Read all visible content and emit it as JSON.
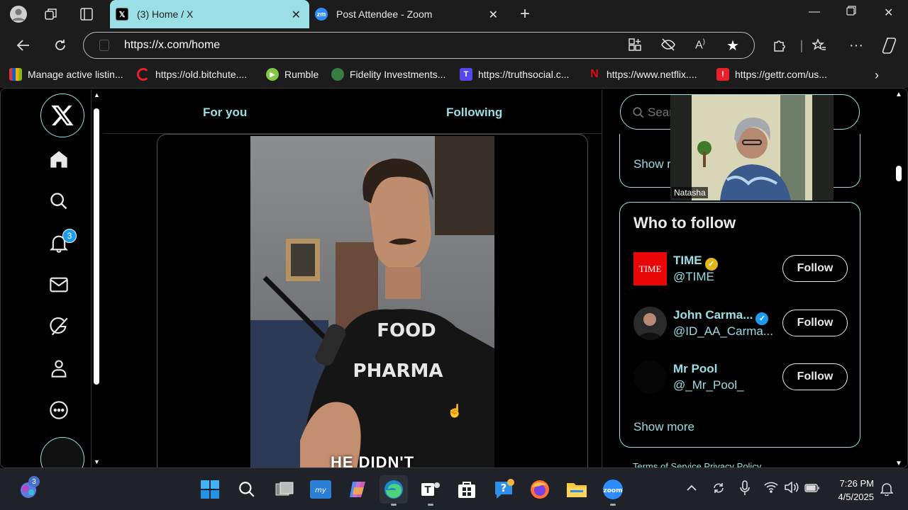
{
  "browser": {
    "tabs": [
      {
        "title": "(3) Home / X",
        "active": true,
        "icon": "x-logo-icon"
      },
      {
        "title": "Post Attendee - Zoom",
        "active": false,
        "icon": "zoom-logo-icon"
      }
    ],
    "address": "https://x.com/home",
    "bookmarks": [
      {
        "label": "Manage active listin...",
        "icon": "ebay-icon"
      },
      {
        "label": "https://old.bitchute....",
        "icon": "bitchute-icon"
      },
      {
        "label": "Rumble",
        "icon": "rumble-icon"
      },
      {
        "label": "Fidelity Investments...",
        "icon": "fidelity-icon"
      },
      {
        "label": "https://truthsocial.c...",
        "icon": "truthsocial-icon"
      },
      {
        "label": "https://www.netflix....",
        "icon": "netflix-icon"
      },
      {
        "label": "https://gettr.com/us...",
        "icon": "gettr-icon"
      }
    ]
  },
  "x": {
    "logo": "X",
    "notifications_badge": "3",
    "feed_tabs": [
      "For you",
      "Following"
    ],
    "video": {
      "shirt_text_1": "FOOD",
      "shirt_text_2": "PHARMA",
      "caption": "HE DIDN'T"
    },
    "search_placeholder": "Sear",
    "top_show_more": "Show r",
    "who_to_follow": {
      "title": "Who to follow",
      "accounts": [
        {
          "name": "TIME",
          "handle": "@TIME",
          "avatar_text": "TIME",
          "verified": "gold",
          "button": "Follow"
        },
        {
          "name": "John Carma...",
          "handle": "@ID_AA_Carma...",
          "verified": "blue",
          "button": "Follow"
        },
        {
          "name": "Mr Pool",
          "handle": "@_Mr_Pool_",
          "verified": "",
          "button": "Follow"
        }
      ],
      "show_more": "Show more"
    },
    "footer_links": "Terms of Service   Privacy Policy"
  },
  "zoom": {
    "participant_name": "Natasha"
  },
  "taskbar": {
    "widgets_badge": "3",
    "time": "7:26 PM",
    "date": "4/5/2025"
  },
  "colors": {
    "accent": "#9adfe6",
    "x_blue": "#1d9bf0",
    "time_red": "#e90606"
  }
}
